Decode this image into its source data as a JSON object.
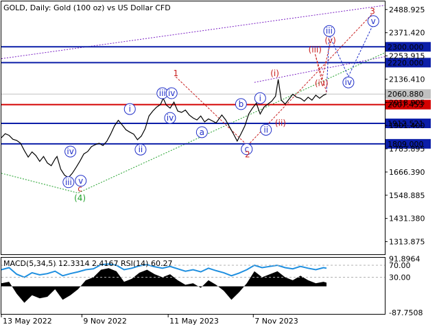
{
  "chart_data": {
    "type": "line",
    "symbol": "GOLD",
    "timeframe": "Daily",
    "description": "Gold (100 oz) vs US Dollar CFD",
    "header": "GOLD, Daily:  Gold (100 oz) vs US Dollar CFD",
    "price_ticks": [
      {
        "label": "2488.925",
        "value": 2488.925
      },
      {
        "label": "2371.420",
        "value": 2371.42
      },
      {
        "label": "2253.915",
        "value": 2253.915
      },
      {
        "label": "2136.410",
        "value": 2136.41
      },
      {
        "label": "2018.905",
        "value": 2018.905
      },
      {
        "label": "1901.400",
        "value": 1901.4
      },
      {
        "label": "1783.895",
        "value": 1783.895
      },
      {
        "label": "1666.390",
        "value": 1666.39
      },
      {
        "label": "1548.885",
        "value": 1548.885
      },
      {
        "label": "1431.380",
        "value": 1431.38
      },
      {
        "label": "1313.875",
        "value": 1313.875
      }
    ],
    "price_range": [
      1250,
      2530
    ],
    "date_labels": [
      {
        "label": "13 May 2022",
        "t": 0
      },
      {
        "label": "9 Nov 2022",
        "t": 0.21
      },
      {
        "label": "11 May 2023",
        "t": 0.435
      },
      {
        "label": "7 Nov 2023",
        "t": 0.657
      }
    ],
    "levels": [
      {
        "name": "resistance-2300",
        "label": "2300.000",
        "value": 2300.0,
        "color": "#0b1ea8",
        "box": "#0b1ea8"
      },
      {
        "name": "resistance-2220",
        "label": "2220.000",
        "value": 2220.0,
        "color": "#0b1ea8",
        "box": "#0b1ea8"
      },
      {
        "name": "current-price",
        "label": "2060.880",
        "value": 2060.88,
        "color": "#c0c0c0",
        "box": "#c0c0c0"
      },
      {
        "name": "pivot-2007",
        "label": "2007.453",
        "value": 2007.453,
        "color": "#d40000",
        "box": "#d40000"
      },
      {
        "name": "support-1912",
        "label": "1912.521",
        "value": 1912.521,
        "color": "#0b1ea8",
        "box": "#0b1ea8"
      },
      {
        "name": "support-1809",
        "label": "1809.000",
        "value": 1809.0,
        "color": "#0b1ea8",
        "box": "#0b1ea8"
      }
    ],
    "price_series": [
      [
        0,
        1840
      ],
      [
        0.01,
        1860
      ],
      [
        0.02,
        1852
      ],
      [
        0.03,
        1832
      ],
      [
        0.04,
        1826
      ],
      [
        0.05,
        1812
      ],
      [
        0.06,
        1775
      ],
      [
        0.07,
        1742
      ],
      [
        0.08,
        1768
      ],
      [
        0.09,
        1750
      ],
      [
        0.1,
        1720
      ],
      [
        0.11,
        1745
      ],
      [
        0.12,
        1712
      ],
      [
        0.13,
        1698
      ],
      [
        0.14,
        1732
      ],
      [
        0.145,
        1745
      ],
      [
        0.155,
        1680
      ],
      [
        0.165,
        1650
      ],
      [
        0.175,
        1638
      ],
      [
        0.185,
        1660
      ],
      [
        0.195,
        1690
      ],
      [
        0.205,
        1722
      ],
      [
        0.215,
        1758
      ],
      [
        0.225,
        1770
      ],
      [
        0.235,
        1795
      ],
      [
        0.245,
        1805
      ],
      [
        0.255,
        1812
      ],
      [
        0.265,
        1800
      ],
      [
        0.275,
        1822
      ],
      [
        0.285,
        1858
      ],
      [
        0.295,
        1900
      ],
      [
        0.305,
        1928
      ],
      [
        0.315,
        1905
      ],
      [
        0.325,
        1880
      ],
      [
        0.335,
        1868
      ],
      [
        0.345,
        1858
      ],
      [
        0.355,
        1830
      ],
      [
        0.365,
        1848
      ],
      [
        0.375,
        1885
      ],
      [
        0.385,
        1950
      ],
      [
        0.395,
        1975
      ],
      [
        0.405,
        1995
      ],
      [
        0.415,
        2008
      ],
      [
        0.422,
        2040
      ],
      [
        0.43,
        2005
      ],
      [
        0.44,
        1990
      ],
      [
        0.45,
        2020
      ],
      [
        0.46,
        1975
      ],
      [
        0.47,
        1968
      ],
      [
        0.48,
        1980
      ],
      [
        0.49,
        1955
      ],
      [
        0.5,
        1940
      ],
      [
        0.51,
        1930
      ],
      [
        0.52,
        1950
      ],
      [
        0.53,
        1920
      ],
      [
        0.54,
        1935
      ],
      [
        0.55,
        1925
      ],
      [
        0.56,
        1915
      ],
      [
        0.575,
        1955
      ],
      [
        0.585,
        1930
      ],
      [
        0.595,
        1895
      ],
      [
        0.605,
        1860
      ],
      [
        0.615,
        1823
      ],
      [
        0.625,
        1860
      ],
      [
        0.635,
        1900
      ],
      [
        0.645,
        1960
      ],
      [
        0.655,
        1990
      ],
      [
        0.665,
        2015
      ],
      [
        0.675,
        1960
      ],
      [
        0.685,
        1995
      ],
      [
        0.695,
        2010
      ],
      [
        0.705,
        2025
      ],
      [
        0.715,
        2050
      ],
      [
        0.722,
        2135
      ],
      [
        0.73,
        2030
      ],
      [
        0.74,
        2010
      ],
      [
        0.75,
        2035
      ],
      [
        0.76,
        2060
      ],
      [
        0.77,
        2045
      ],
      [
        0.78,
        2040
      ],
      [
        0.79,
        2025
      ],
      [
        0.8,
        2045
      ],
      [
        0.81,
        2030
      ],
      [
        0.82,
        2055
      ],
      [
        0.83,
        2040
      ],
      [
        0.84,
        2055
      ],
      [
        0.848,
        2062
      ]
    ],
    "trend_lines": [
      {
        "name": "upper-channel",
        "style": "dotted",
        "color": "#7a1fc4",
        "points": [
          [
            0,
            2240
          ],
          [
            1,
            2510
          ]
        ]
      },
      {
        "name": "lower-channel",
        "style": "dotted",
        "color": "#7a1fc4",
        "points": [
          [
            0.66,
            2120
          ],
          [
            1,
            2250
          ]
        ]
      },
      {
        "name": "wave-iv-base",
        "style": "dotted",
        "color": "#21a12b",
        "points": [
          [
            0,
            1660
          ],
          [
            0.2,
            1560
          ],
          [
            1,
            2270
          ]
        ]
      }
    ],
    "wave_labels": [
      {
        "text": "iii",
        "style": "circle",
        "color": "#1f2ec8",
        "t": 0.175,
        "v": 1615
      },
      {
        "text": "iv",
        "style": "circle",
        "color": "#1f2ec8",
        "t": 0.18,
        "v": 1770
      },
      {
        "text": "v",
        "style": "circle",
        "color": "#1f2ec8",
        "t": 0.207,
        "v": 1622
      },
      {
        "text": "c",
        "style": "plain",
        "color": "#c81e1e",
        "t": 0.205,
        "v": 1582
      },
      {
        "text": "(4)",
        "style": "plain",
        "color": "#21a12b",
        "t": 0.205,
        "v": 1535
      },
      {
        "text": "i",
        "style": "circle",
        "color": "#1f2ec8",
        "t": 0.335,
        "v": 1985
      },
      {
        "text": "ii",
        "style": "circle",
        "color": "#1f2ec8",
        "t": 0.363,
        "v": 1780
      },
      {
        "text": "iii",
        "style": "circle",
        "color": "#1f2ec8",
        "t": 0.42,
        "v": 2065
      },
      {
        "text": "iv",
        "style": "circle",
        "color": "#1f2ec8",
        "t": 0.444,
        "v": 2065
      },
      {
        "text": "iv",
        "style": "circle",
        "color": "#1f2ec8",
        "t": 0.44,
        "v": 1940
      },
      {
        "text": "1",
        "style": "plain",
        "color": "#c81e1e",
        "t": 0.455,
        "v": 2165
      },
      {
        "text": "a",
        "style": "circle",
        "color": "#1f2ec8",
        "t": 0.523,
        "v": 1868
      },
      {
        "text": "b",
        "style": "circle",
        "color": "#1f2ec8",
        "t": 0.625,
        "v": 2010
      },
      {
        "text": "c",
        "style": "circle",
        "color": "#1f2ec8",
        "t": 0.64,
        "v": 1782
      },
      {
        "text": "2",
        "style": "plain",
        "color": "#c81e1e",
        "t": 0.642,
        "v": 1755
      },
      {
        "text": "i",
        "style": "circle",
        "color": "#1f2ec8",
        "t": 0.675,
        "v": 2040
      },
      {
        "text": "ii",
        "style": "circle",
        "color": "#1f2ec8",
        "t": 0.69,
        "v": 1880
      },
      {
        "text": "(i)",
        "style": "plain",
        "color": "#c81e1e",
        "t": 0.713,
        "v": 2165
      },
      {
        "text": "(ii)",
        "style": "plain",
        "color": "#c81e1e",
        "t": 0.728,
        "v": 1915
      },
      {
        "text": "(iii)",
        "style": "plain",
        "color": "#c81e1e",
        "t": 0.818,
        "v": 2285
      },
      {
        "text": "(iv)",
        "style": "plain",
        "color": "#c81e1e",
        "t": 0.835,
        "v": 2115
      },
      {
        "text": "(v)",
        "style": "plain",
        "color": "#c81e1e",
        "t": 0.858,
        "v": 2332
      },
      {
        "text": "iii",
        "style": "circle",
        "color": "#1f2ec8",
        "t": 0.855,
        "v": 2380
      },
      {
        "text": "iv",
        "style": "circle",
        "color": "#1f2ec8",
        "t": 0.905,
        "v": 2120
      },
      {
        "text": "3",
        "style": "plain",
        "color": "#c81e1e",
        "t": 0.968,
        "v": 2480
      },
      {
        "text": "v",
        "style": "circle",
        "color": "#1f2ec8",
        "t": 0.97,
        "v": 2430
      }
    ],
    "forecast_lines": [
      {
        "name": "wave-1-2-red",
        "color": "#c81e1e",
        "points": [
          [
            0.455,
            2148
          ],
          [
            0.642,
            1800
          ],
          [
            0.968,
            2468
          ]
        ]
      },
      {
        "name": "wave-blue-path",
        "color": "#1f2ec8",
        "points": [
          [
            0.848,
            2070
          ],
          [
            0.855,
            2360
          ],
          [
            0.905,
            2150
          ],
          [
            0.97,
            2415
          ]
        ]
      },
      {
        "name": "wave-red-path",
        "color": "#c81e1e",
        "points": [
          [
            0.848,
            2070
          ],
          [
            0.818,
            2265
          ],
          [
            0.835,
            2130
          ],
          [
            0.858,
            2320
          ]
        ]
      }
    ],
    "macd_panel": {
      "header": "MACD(5,34,5) 12.3314 2.4167 RSI(14) 60.27",
      "ticks": [
        {
          "label": "91.8964",
          "value": 91.8964
        },
        {
          "label": "70.00",
          "value": 70
        },
        {
          "label": "30.00",
          "value": 30
        },
        {
          "label": "-87.7508",
          "value": -87.7508
        }
      ],
      "range": [
        -92,
        95
      ],
      "rsi": [
        [
          0,
          55
        ],
        [
          0.02,
          62
        ],
        [
          0.04,
          40
        ],
        [
          0.06,
          30
        ],
        [
          0.08,
          45
        ],
        [
          0.1,
          38
        ],
        [
          0.12,
          42
        ],
        [
          0.14,
          50
        ],
        [
          0.16,
          35
        ],
        [
          0.18,
          42
        ],
        [
          0.2,
          48
        ],
        [
          0.22,
          55
        ],
        [
          0.24,
          58
        ],
        [
          0.26,
          72
        ],
        [
          0.28,
          74
        ],
        [
          0.3,
          70
        ],
        [
          0.32,
          55
        ],
        [
          0.34,
          60
        ],
        [
          0.36,
          68
        ],
        [
          0.38,
          72
        ],
        [
          0.4,
          65
        ],
        [
          0.42,
          60
        ],
        [
          0.44,
          66
        ],
        [
          0.46,
          58
        ],
        [
          0.48,
          50
        ],
        [
          0.5,
          55
        ],
        [
          0.52,
          48
        ],
        [
          0.54,
          60
        ],
        [
          0.56,
          52
        ],
        [
          0.58,
          45
        ],
        [
          0.6,
          35
        ],
        [
          0.62,
          44
        ],
        [
          0.64,
          55
        ],
        [
          0.66,
          70
        ],
        [
          0.68,
          62
        ],
        [
          0.7,
          66
        ],
        [
          0.72,
          70
        ],
        [
          0.74,
          62
        ],
        [
          0.76,
          58
        ],
        [
          0.78,
          66
        ],
        [
          0.8,
          60
        ],
        [
          0.82,
          55
        ],
        [
          0.84,
          62
        ],
        [
          0.848,
          60
        ]
      ],
      "macd": [
        [
          0,
          10
        ],
        [
          0.02,
          15
        ],
        [
          0.04,
          -25
        ],
        [
          0.06,
          -55
        ],
        [
          0.08,
          -30
        ],
        [
          0.1,
          -40
        ],
        [
          0.12,
          -35
        ],
        [
          0.14,
          -10
        ],
        [
          0.16,
          -45
        ],
        [
          0.18,
          -30
        ],
        [
          0.2,
          -10
        ],
        [
          0.22,
          20
        ],
        [
          0.24,
          30
        ],
        [
          0.26,
          55
        ],
        [
          0.28,
          60
        ],
        [
          0.3,
          50
        ],
        [
          0.32,
          15
        ],
        [
          0.34,
          25
        ],
        [
          0.36,
          45
        ],
        [
          0.38,
          55
        ],
        [
          0.4,
          40
        ],
        [
          0.42,
          30
        ],
        [
          0.44,
          40
        ],
        [
          0.46,
          20
        ],
        [
          0.48,
          5
        ],
        [
          0.5,
          10
        ],
        [
          0.52,
          -5
        ],
        [
          0.54,
          20
        ],
        [
          0.56,
          5
        ],
        [
          0.58,
          -15
        ],
        [
          0.6,
          -45
        ],
        [
          0.62,
          -20
        ],
        [
          0.64,
          10
        ],
        [
          0.66,
          50
        ],
        [
          0.68,
          30
        ],
        [
          0.7,
          40
        ],
        [
          0.72,
          50
        ],
        [
          0.74,
          30
        ],
        [
          0.76,
          20
        ],
        [
          0.78,
          35
        ],
        [
          0.8,
          20
        ],
        [
          0.82,
          10
        ],
        [
          0.84,
          15
        ],
        [
          0.848,
          12
        ]
      ]
    }
  },
  "colors": {
    "background": "#ffffff",
    "price_line": "#000000",
    "rsi_line": "#1e8fe0",
    "macd_fill": "#000000",
    "grid": "#d8d8d8",
    "blue_level": "#0b1ea8",
    "red_level": "#d40000"
  }
}
